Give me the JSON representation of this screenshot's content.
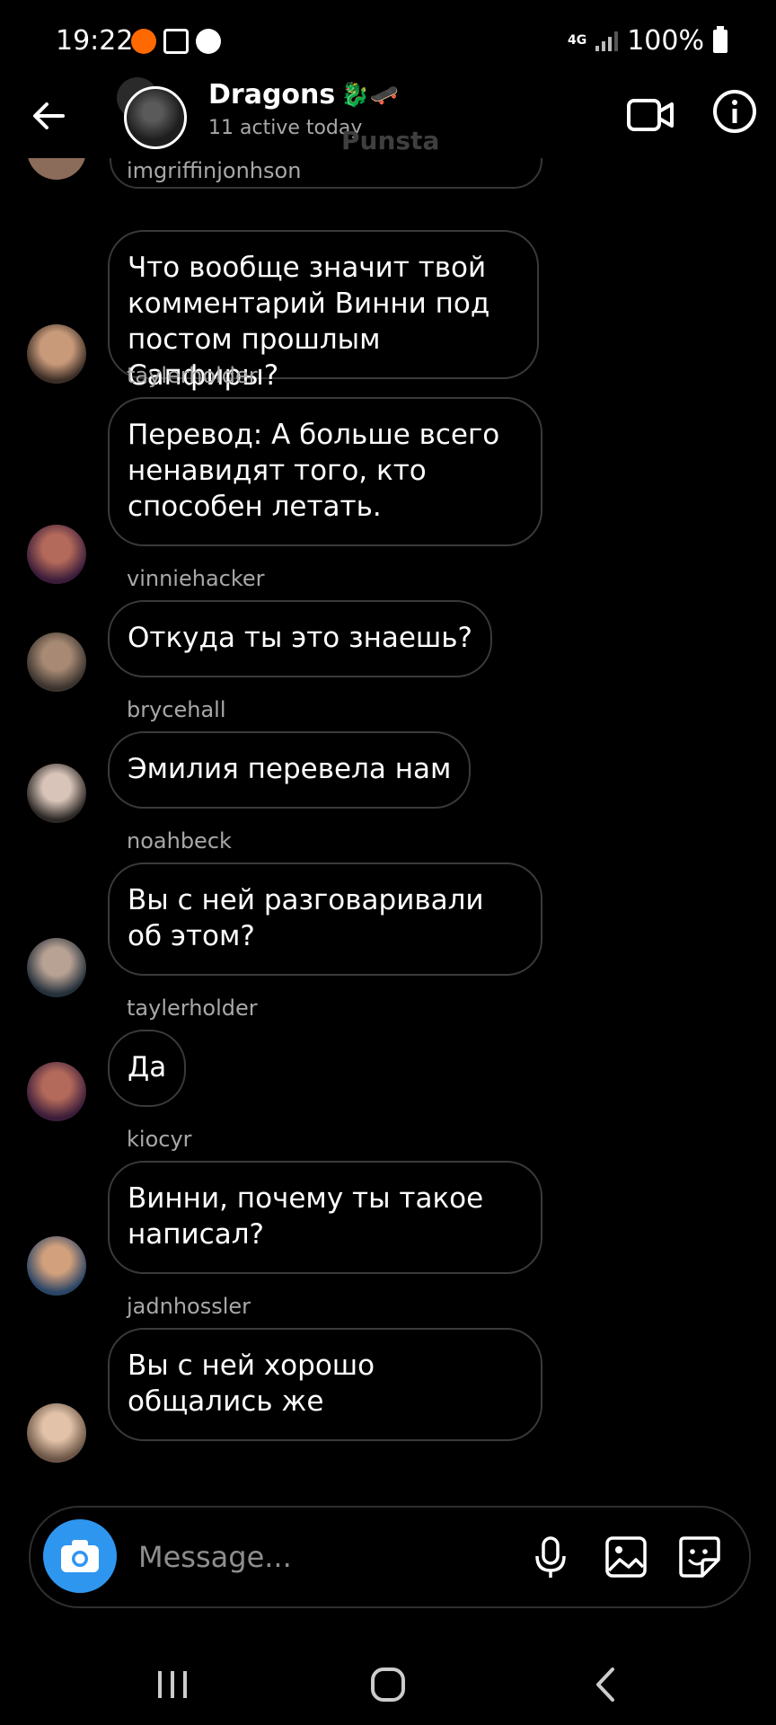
{
  "status_bar": {
    "time": "19:22",
    "network": "4G",
    "battery": "100%",
    "icons": [
      "app-notification-icon",
      "gallery-icon",
      "app-icon"
    ]
  },
  "header": {
    "title": "Dragons",
    "title_emojis": "🐉🛹",
    "subtitle": "11 active today",
    "watermark": "Punsta"
  },
  "messages": [
    {
      "username": "imgriffinjonhson",
      "text": "Что вообще значит твой комментарий  Винни под постом прошлым Сапфиры?"
    },
    {
      "username": "taylerholder",
      "text": "Перевод: А больше всего ненавидят  того, кто способен летать."
    },
    {
      "username": "vinniehacker",
      "text": "Откуда ты это знаешь?"
    },
    {
      "username": "brycehall",
      "text": "Эмилия перевела нам"
    },
    {
      "username": "noahbeck",
      "text": "Вы с ней разговаривали об этом?"
    },
    {
      "username": "taylerholder",
      "text": "Да"
    },
    {
      "username": "kiocyr",
      "text": "Винни, почему ты такое написал?"
    },
    {
      "username": "jadnhossler",
      "text": "Вы с ней хорошо общались же"
    }
  ],
  "composer": {
    "placeholder": "Message..."
  },
  "colors": {
    "background": "#000000",
    "bubble_border": "#3a3a3a",
    "camera_button": "#2f96f0",
    "secondary_text": "#a8a8a8"
  }
}
